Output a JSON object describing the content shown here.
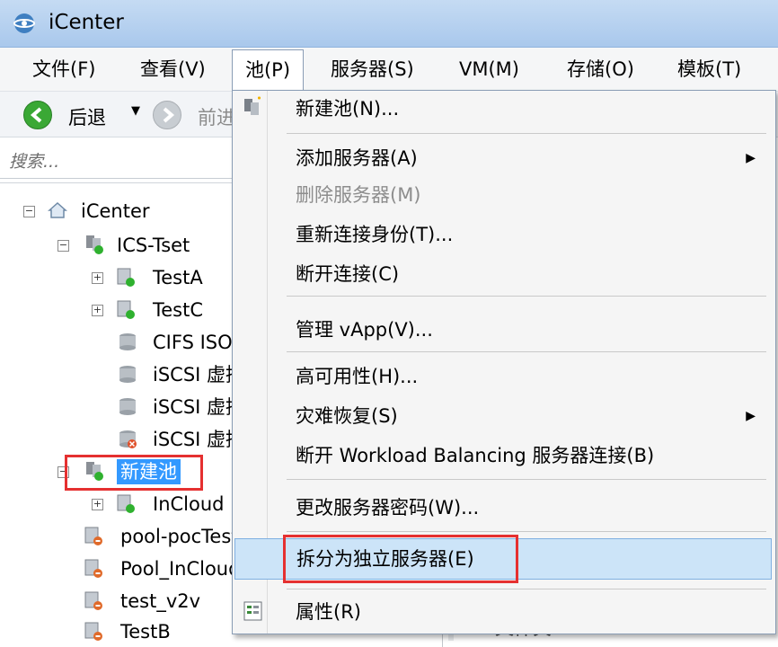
{
  "window": {
    "title": "iCenter"
  },
  "menubar": [
    {
      "label": "文件(F)",
      "open": false
    },
    {
      "label": "查看(V)",
      "open": false
    },
    {
      "label": "池(P)",
      "open": true
    },
    {
      "label": "服务器(S)",
      "open": false
    },
    {
      "label": "VM(M)",
      "open": false
    },
    {
      "label": "存储(O)",
      "open": false
    },
    {
      "label": "模板(T)",
      "open": false
    }
  ],
  "toolbar": {
    "back_label": "后退",
    "forward_label": "前进"
  },
  "search": {
    "placeholder": "搜索..."
  },
  "tree": [
    {
      "label": "iCenter",
      "icon": "home-icon"
    },
    {
      "label": "ICS-Tset",
      "icon": "pool-icon"
    },
    {
      "label": "TestA",
      "icon": "server-online-icon"
    },
    {
      "label": "TestC",
      "icon": "server-online-icon"
    },
    {
      "label": "CIFS ISO 库",
      "icon": "storage-icon"
    },
    {
      "label": "iSCSI 虚拟磁盘存储",
      "icon": "storage-icon"
    },
    {
      "label": "iSCSI 虚拟磁盘存储",
      "icon": "storage-icon"
    },
    {
      "label": "iSCSI 虚拟磁盘存储",
      "icon": "storage-error-icon"
    },
    {
      "label": "新建池",
      "icon": "pool-icon",
      "selected": true
    },
    {
      "label": "InCloud",
      "icon": "server-online-icon"
    },
    {
      "label": "pool-pocTest",
      "icon": "server-offline-icon"
    },
    {
      "label": "Pool_InCloud",
      "icon": "server-offline-icon"
    },
    {
      "label": "test_v2v",
      "icon": "server-offline-icon"
    },
    {
      "label": "TestB",
      "icon": "server-offline-icon"
    }
  ],
  "right_pane": {
    "visible_label": "文件夹:"
  },
  "pool_menu": {
    "items": [
      {
        "label": "新建池(N)...",
        "enabled": true,
        "icon": "new-pool-icon"
      },
      {
        "label": "添加服务器(A)",
        "enabled": true,
        "submenu": true
      },
      {
        "label": "删除服务器(M)",
        "enabled": false
      },
      {
        "label": "重新连接身份(T)...",
        "enabled": true
      },
      {
        "label": "断开连接(C)",
        "enabled": true
      },
      {
        "label": "管理 vApp(V)...",
        "enabled": true
      },
      {
        "label": "高可用性(H)...",
        "enabled": true
      },
      {
        "label": "灾难恢复(S)",
        "enabled": true,
        "submenu": true
      },
      {
        "label": "断开 Workload Balancing 服务器连接(B)",
        "enabled": true
      },
      {
        "label": "更改服务器密码(W)...",
        "enabled": true
      },
      {
        "label": "拆分为独立服务器(E)",
        "enabled": true,
        "highlighted": true
      },
      {
        "label": "属性(R)",
        "enabled": true,
        "icon": "properties-icon"
      }
    ]
  },
  "colors": {
    "highlight": "#cce4f8",
    "selection": "#3399ff",
    "annotation": "#e53030"
  }
}
